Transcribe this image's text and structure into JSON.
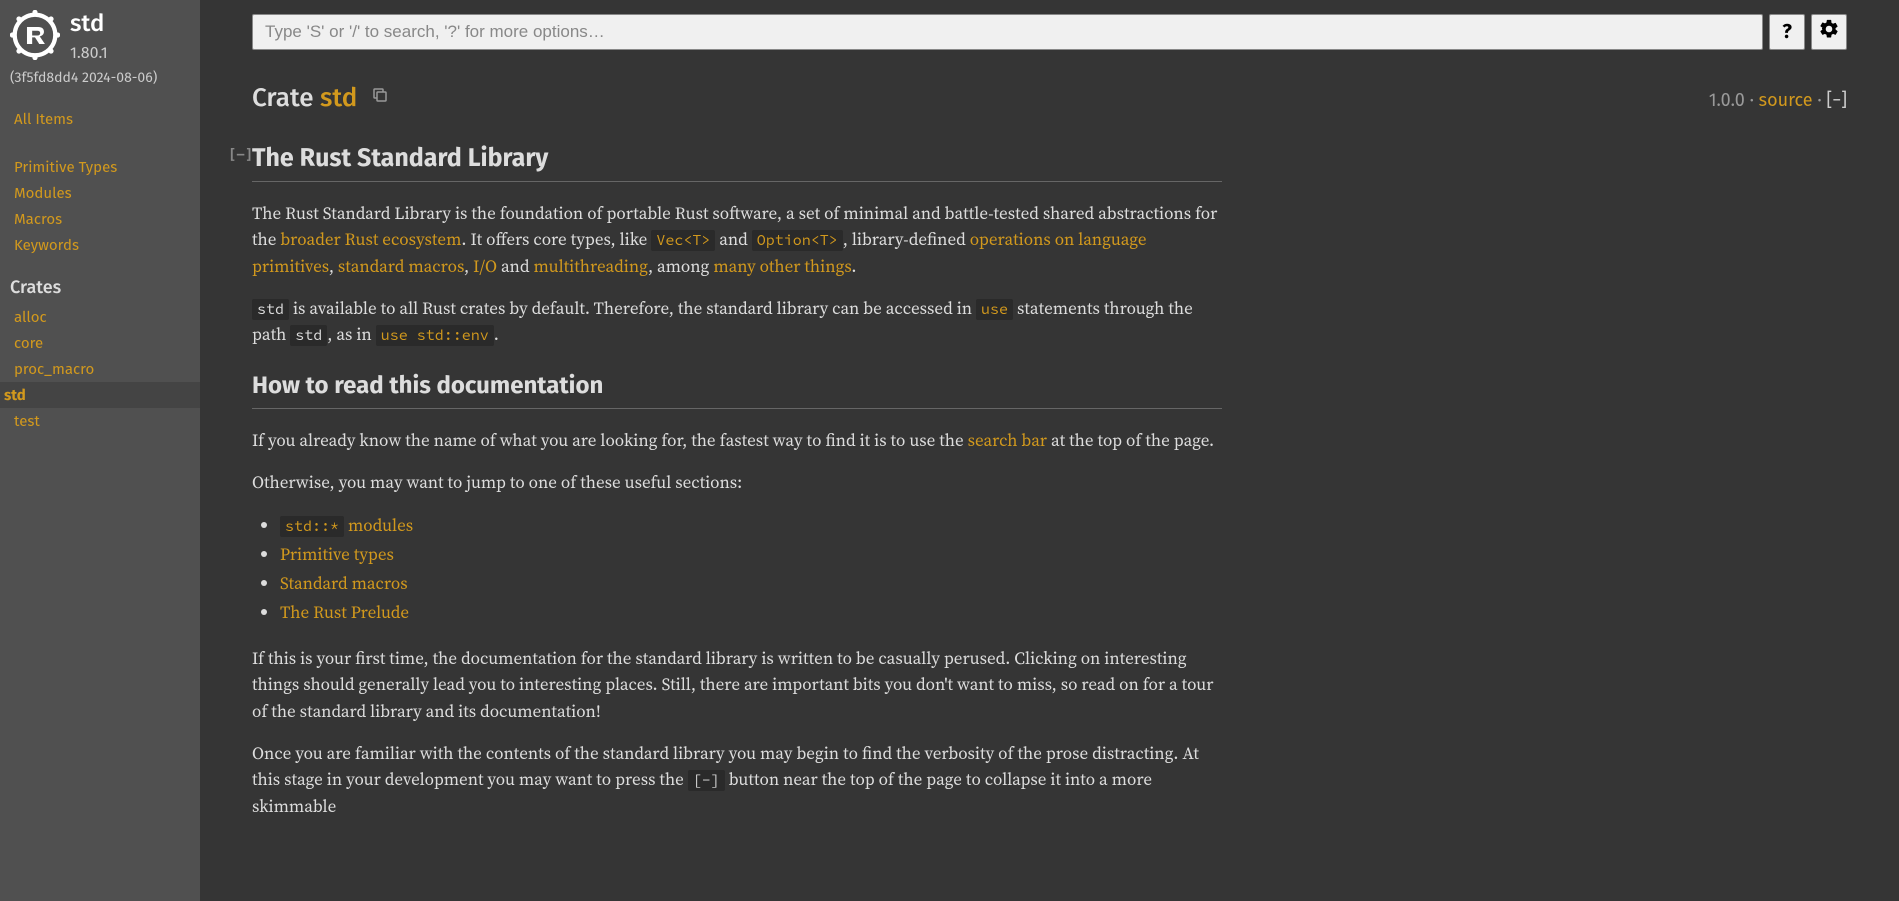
{
  "sidebar": {
    "crate_name": "std",
    "version": "1.80.1",
    "hash": "(3f5fd8dd4 2024-08-06)",
    "all_items": "All Items",
    "nav": [
      "Primitive Types",
      "Modules",
      "Macros",
      "Keywords"
    ],
    "crates_label": "Crates",
    "crates": [
      "alloc",
      "core",
      "proc_macro",
      "std",
      "test"
    ],
    "current_crate": "std"
  },
  "search": {
    "placeholder": "Type 'S' or '/' to search, '?' for more options…"
  },
  "heading": {
    "keyword": "Crate",
    "name": "std",
    "version": "1.0.0",
    "source": "source",
    "toggle": "[−]"
  },
  "section1": {
    "title": "The Rust Standard Library",
    "p1_a": "The Rust Standard Library is the foundation of portable Rust software, a set of minimal and battle-tested shared abstractions for the ",
    "p1_link1": "broader Rust ecosystem",
    "p1_b": ". It offers core types, like ",
    "p1_code1": "Vec<T>",
    "p1_c": " and ",
    "p1_code2": "Option<T>",
    "p1_d": ", library-defined ",
    "p1_link2": "operations on language primitives",
    "p1_e": ", ",
    "p1_link3": "standard macros",
    "p1_f": ", ",
    "p1_link4": "I/O",
    "p1_g": " and ",
    "p1_link5": "multithreading",
    "p1_h": ", among ",
    "p1_link6": "many other things",
    "p1_i": ".",
    "p2_code1": "std",
    "p2_a": " is available to all Rust crates by default. Therefore, the standard library can be accessed in ",
    "p2_code2": "use",
    "p2_b": " statements through the path ",
    "p2_code3": "std",
    "p2_c": ", as in ",
    "p2_code4": "use std::env",
    "p2_d": "."
  },
  "section2": {
    "title": "How to read this documentation",
    "p1_a": "If you already know the name of what you are looking for, the fastest way to find it is to use the ",
    "p1_link1": "search bar",
    "p1_b": " at the top of the page.",
    "p2": "Otherwise, you may want to jump to one of these useful sections:",
    "li1_code": "std::*",
    "li1_text": " modules",
    "li2": "Primitive types",
    "li3": "Standard macros",
    "li4": "The Rust Prelude",
    "p3": "If this is your first time, the documentation for the standard library is written to be casually perused. Clicking on interesting things should generally lead you to interesting places. Still, there are important bits you don't want to miss, so read on for a tour of the standard library and its documentation!",
    "p4_a": "Once you are familiar with the contents of the standard library you may begin to find the verbosity of the prose distracting. At this stage in your development you may want to press the ",
    "p4_code": "[-]",
    "p4_b": " button near the top of the page to collapse it into a more skimmable"
  }
}
